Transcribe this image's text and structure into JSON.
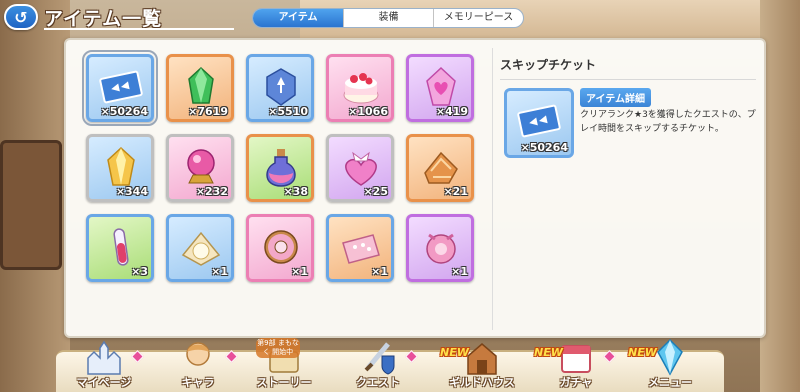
{
  "header": {
    "back_label": "↺",
    "title": "アイテム一覧"
  },
  "tabs": [
    {
      "label": "アイテム",
      "active": true
    },
    {
      "label": "装備",
      "active": false
    },
    {
      "label": "メモリーピース",
      "active": false
    }
  ],
  "items": [
    {
      "icon": "skip-ticket-icon",
      "qty": "×50264",
      "color": "blue",
      "selected": true
    },
    {
      "icon": "green-crystal-icon",
      "qty": "×7619",
      "color": "orange"
    },
    {
      "icon": "blue-gem-icon",
      "qty": "×5510",
      "color": "blue"
    },
    {
      "icon": "strawberry-cake-icon",
      "qty": "×1066",
      "color": "pink"
    },
    {
      "icon": "pink-heart-crystal-icon",
      "qty": "×419",
      "color": "purple"
    },
    {
      "icon": "gold-crystal-icon",
      "qty": "×344",
      "color": "silver"
    },
    {
      "icon": "pink-orb-stand-icon",
      "qty": "×232",
      "color": "silver"
    },
    {
      "icon": "potion-bottle-icon",
      "qty": "×38",
      "color": "orange"
    },
    {
      "icon": "heart-bow-icon",
      "qty": "×25",
      "color": "purple"
    },
    {
      "icon": "pie-icon",
      "qty": "×21",
      "color": "orange"
    },
    {
      "icon": "test-tube-icon",
      "qty": "×3",
      "color": "blue"
    },
    {
      "icon": "pearl-cloth-icon",
      "qty": "×1",
      "color": "blue"
    },
    {
      "icon": "donut-icon",
      "qty": "×1",
      "color": "pink"
    },
    {
      "icon": "pink-cloth-icon",
      "qty": "×1",
      "color": "orange"
    },
    {
      "icon": "pink-ornament-icon",
      "qty": "×1",
      "color": "purple"
    }
  ],
  "detail": {
    "name": "スキップチケット",
    "qty": "×50264",
    "badge": "アイテム詳細",
    "description": "クリアランク★3を獲得したクエストの、プレイ時間をスキップするチケット。"
  },
  "menu": [
    {
      "label": "マイページ",
      "icon": "castle-icon",
      "badge": ""
    },
    {
      "label": "キャラ",
      "icon": "character-icon",
      "badge": ""
    },
    {
      "label": "ストーリー",
      "icon": "scroll-icon",
      "badge": "",
      "event": "第9部 まもなく 開始中"
    },
    {
      "label": "クエスト",
      "icon": "sword-shield-icon",
      "badge": ""
    },
    {
      "label": "ギルドハウス",
      "icon": "guild-house-icon",
      "badge": "NEW"
    },
    {
      "label": "ガチャ",
      "icon": "gacha-icon",
      "badge": "NEW"
    },
    {
      "label": "メニュー",
      "icon": "menu-crystal-icon",
      "badge": "NEW"
    }
  ],
  "colors": {
    "accent": "#2a74d0",
    "new_badge": "#ffe04a",
    "notify_diamond": "#e8509a"
  }
}
